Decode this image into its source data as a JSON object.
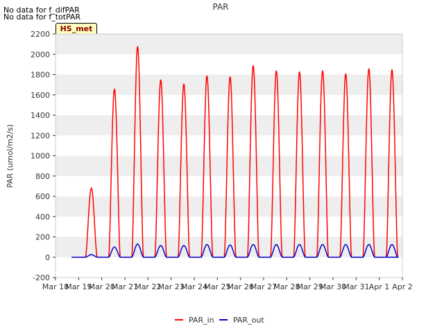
{
  "notes": [
    "No data for f_difPAR",
    "No data for f_totPAR"
  ],
  "site_badge": "HS_met",
  "chart_data": {
    "type": "line",
    "title": "PAR",
    "xlabel": "",
    "ylabel": "PAR (umol/m2/s)",
    "xlim": [
      "Mar 18",
      "Apr 2"
    ],
    "ylim": [
      -200,
      2200
    ],
    "yticks": [
      -200,
      0,
      200,
      400,
      600,
      800,
      1000,
      1200,
      1400,
      1600,
      1800,
      2000,
      2200
    ],
    "xticks": [
      "Mar 18",
      "Mar 19",
      "Mar 20",
      "Mar 21",
      "Mar 22",
      "Mar 23",
      "Mar 24",
      "Mar 25",
      "Mar 26",
      "Mar 27",
      "Mar 28",
      "Mar 29",
      "Mar 30",
      "Mar 31",
      "Apr 1",
      "Apr 2"
    ],
    "grid": "horizontal bands",
    "legend": "bottom-center",
    "series": [
      {
        "name": "PAR_in",
        "color": "#ff0000",
        "daily_peaks": [
          {
            "day": "Mar 19",
            "peak": 680
          },
          {
            "day": "Mar 20",
            "peak": 1660
          },
          {
            "day": "Mar 21",
            "peak": 2080
          },
          {
            "day": "Mar 22",
            "peak": 1750
          },
          {
            "day": "Mar 23",
            "peak": 1710
          },
          {
            "day": "Mar 24",
            "peak": 1790
          },
          {
            "day": "Mar 25",
            "peak": 1780
          },
          {
            "day": "Mar 26",
            "peak": 1890
          },
          {
            "day": "Mar 27",
            "peak": 1840
          },
          {
            "day": "Mar 28",
            "peak": 1830
          },
          {
            "day": "Mar 29",
            "peak": 1840
          },
          {
            "day": "Mar 30",
            "peak": 1810
          },
          {
            "day": "Mar 31",
            "peak": 1860
          },
          {
            "day": "Apr 1",
            "peak": 1850
          }
        ]
      },
      {
        "name": "PAR_out",
        "color": "#0000cc",
        "daily_peaks": [
          {
            "day": "Mar 19",
            "peak": 25
          },
          {
            "day": "Mar 20",
            "peak": 100
          },
          {
            "day": "Mar 21",
            "peak": 130
          },
          {
            "day": "Mar 22",
            "peak": 115
          },
          {
            "day": "Mar 23",
            "peak": 115
          },
          {
            "day": "Mar 24",
            "peak": 125
          },
          {
            "day": "Mar 25",
            "peak": 120
          },
          {
            "day": "Mar 26",
            "peak": 125
          },
          {
            "day": "Mar 27",
            "peak": 125
          },
          {
            "day": "Mar 28",
            "peak": 125
          },
          {
            "day": "Mar 29",
            "peak": 125
          },
          {
            "day": "Mar 30",
            "peak": 125
          },
          {
            "day": "Mar 31",
            "peak": 125
          },
          {
            "day": "Apr 1",
            "peak": 125
          }
        ]
      }
    ]
  }
}
